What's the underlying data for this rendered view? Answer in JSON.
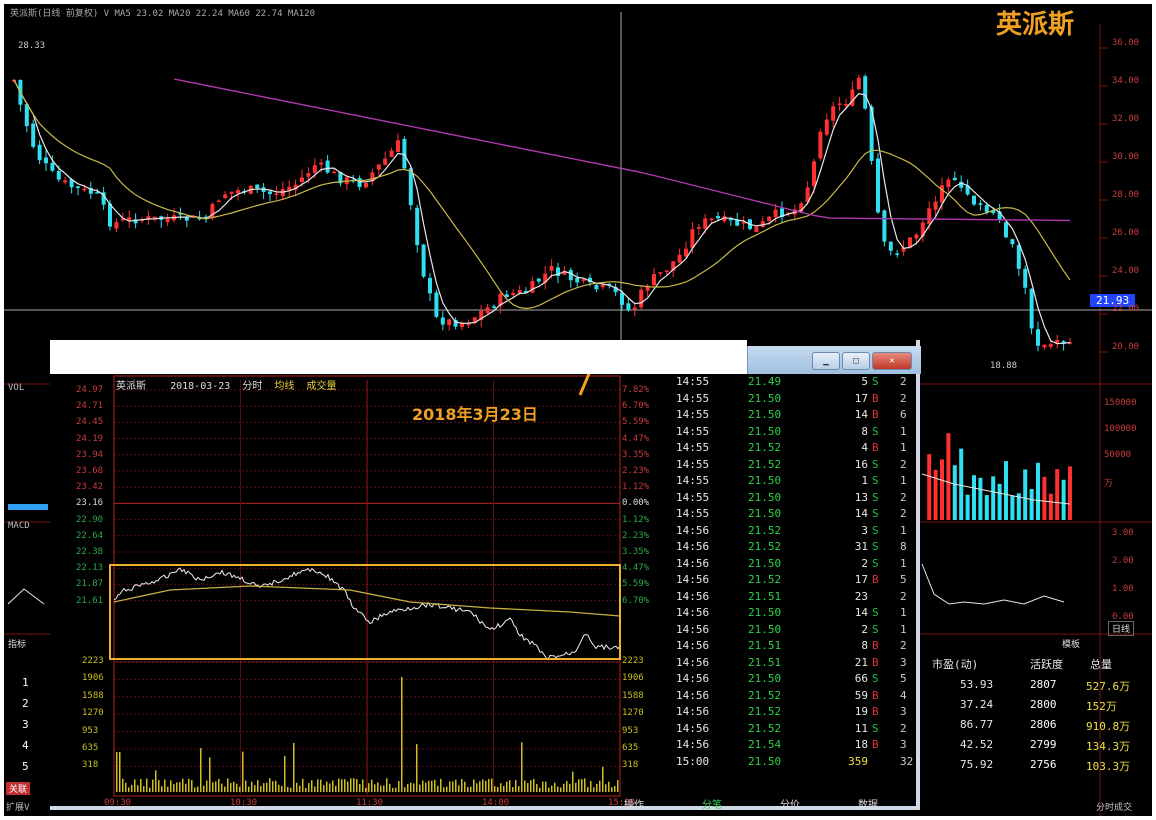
{
  "watermark": "英派斯",
  "main_chart": {
    "header_text": "英派斯(日线 前复权) V MA5 23.02 MA20 22.24 MA60 22.74 MA120",
    "high_label": "28.33",
    "low_label": "18.88",
    "current_price_tag": "21.93",
    "right_axis": [
      "36.00",
      "34.00",
      "32.00",
      "30.00",
      "28.00",
      "26.00",
      "24.00",
      "22.00",
      "20.00"
    ],
    "vol_axis": [
      "150000",
      "100000",
      "50000",
      "万"
    ],
    "macd_axis": [
      "3.00",
      "2.00",
      "1.00",
      "0.00"
    ],
    "left_labels": {
      "vol": "VOL",
      "macd": "MACD"
    },
    "period_button": "日线",
    "colors": {
      "up": "#ff3030",
      "down": "#30e0f0",
      "ma5": "#e8e8e8",
      "ma20": "#c8b848",
      "ma60": "#b038b0"
    }
  },
  "intraday": {
    "title": "英派斯",
    "date": "2018-03-23",
    "mode": "分时",
    "legend": [
      "均线",
      "成交量"
    ],
    "price_axis": [
      "24.97",
      "24.71",
      "24.45",
      "24.19",
      "23.94",
      "23.68",
      "23.42",
      "23.16",
      "22.90",
      "22.64",
      "22.38",
      "22.13",
      "21.87",
      "21.61"
    ],
    "pct_axis": [
      "7.82%",
      "6.70%",
      "5.59%",
      "4.47%",
      "3.35%",
      "2.23%",
      "1.12%",
      "0.00%",
      "1.12%",
      "2.23%",
      "3.35%",
      "4.47%",
      "5.59%",
      "6.70%"
    ],
    "vol_axis": [
      "2223",
      "1906",
      "1588",
      "1270",
      "953",
      "635",
      "318"
    ],
    "time_axis": [
      "09:30",
      "10:30",
      "11:30",
      "14:00",
      "15:00"
    ],
    "time_axis_right": "15:00"
  },
  "annotation": "2018年3月23日",
  "tick_trades": [
    {
      "time": "14:55",
      "price": "21.49",
      "vol": "5",
      "bs": "S",
      "n": "2"
    },
    {
      "time": "14:55",
      "price": "21.50",
      "vol": "17",
      "bs": "B",
      "n": "2"
    },
    {
      "time": "14:55",
      "price": "21.50",
      "vol": "14",
      "bs": "B",
      "n": "6"
    },
    {
      "time": "14:55",
      "price": "21.50",
      "vol": "8",
      "bs": "S",
      "n": "1"
    },
    {
      "time": "14:55",
      "price": "21.52",
      "vol": "4",
      "bs": "B",
      "n": "1"
    },
    {
      "time": "14:55",
      "price": "21.52",
      "vol": "16",
      "bs": "S",
      "n": "2"
    },
    {
      "time": "14:55",
      "price": "21.50",
      "vol": "1",
      "bs": "S",
      "n": "1"
    },
    {
      "time": "14:55",
      "price": "21.50",
      "vol": "13",
      "bs": "S",
      "n": "2"
    },
    {
      "time": "14:55",
      "price": "21.50",
      "vol": "14",
      "bs": "S",
      "n": "2"
    },
    {
      "time": "14:56",
      "price": "21.52",
      "vol": "3",
      "bs": "S",
      "n": "1"
    },
    {
      "time": "14:56",
      "price": "21.52",
      "vol": "31",
      "bs": "S",
      "n": "8"
    },
    {
      "time": "14:56",
      "price": "21.50",
      "vol": "2",
      "bs": "S",
      "n": "1"
    },
    {
      "time": "14:56",
      "price": "21.52",
      "vol": "17",
      "bs": "B",
      "n": "5"
    },
    {
      "time": "14:56",
      "price": "21.51",
      "vol": "23",
      "bs": "",
      "n": "2"
    },
    {
      "time": "14:56",
      "price": "21.50",
      "vol": "14",
      "bs": "S",
      "n": "1"
    },
    {
      "time": "14:56",
      "price": "21.50",
      "vol": "2",
      "bs": "S",
      "n": "1"
    },
    {
      "time": "14:56",
      "price": "21.51",
      "vol": "8",
      "bs": "B",
      "n": "2"
    },
    {
      "time": "14:56",
      "price": "21.51",
      "vol": "21",
      "bs": "B",
      "n": "3"
    },
    {
      "time": "14:56",
      "price": "21.50",
      "vol": "66",
      "bs": "S",
      "n": "5"
    },
    {
      "time": "14:56",
      "price": "21.52",
      "vol": "59",
      "bs": "B",
      "n": "4"
    },
    {
      "time": "14:56",
      "price": "21.52",
      "vol": "19",
      "bs": "B",
      "n": "3"
    },
    {
      "time": "14:56",
      "price": "21.52",
      "vol": "11",
      "bs": "S",
      "n": "2"
    },
    {
      "time": "14:56",
      "price": "21.54",
      "vol": "18",
      "bs": "B",
      "n": "3"
    },
    {
      "time": "15:00",
      "price": "21.50",
      "vol": "359",
      "bs": "",
      "n": "32"
    }
  ],
  "tick_tabs": [
    "操作",
    "分笔",
    "分价",
    "数据"
  ],
  "level_rows": [
    "1",
    "2",
    "3",
    "4",
    "5"
  ],
  "left_bottom": {
    "kaijian": "关联",
    "kuozhan": "扩展V",
    "tab": "指标"
  },
  "stats": {
    "headers": [
      "市盈(动)",
      "活跃度",
      "总量"
    ],
    "rows": [
      {
        "a": "53.93",
        "b": "2807",
        "c": "527.6万"
      },
      {
        "a": "37.24",
        "b": "2800",
        "c": "152万"
      },
      {
        "a": "86.77",
        "b": "2806",
        "c": "910.8万"
      },
      {
        "a": "42.52",
        "b": "2799",
        "c": "134.3万"
      },
      {
        "a": "75.92",
        "b": "2756",
        "c": "103.3万"
      }
    ],
    "tab": "模板"
  },
  "bottom_right": "分时成交"
}
